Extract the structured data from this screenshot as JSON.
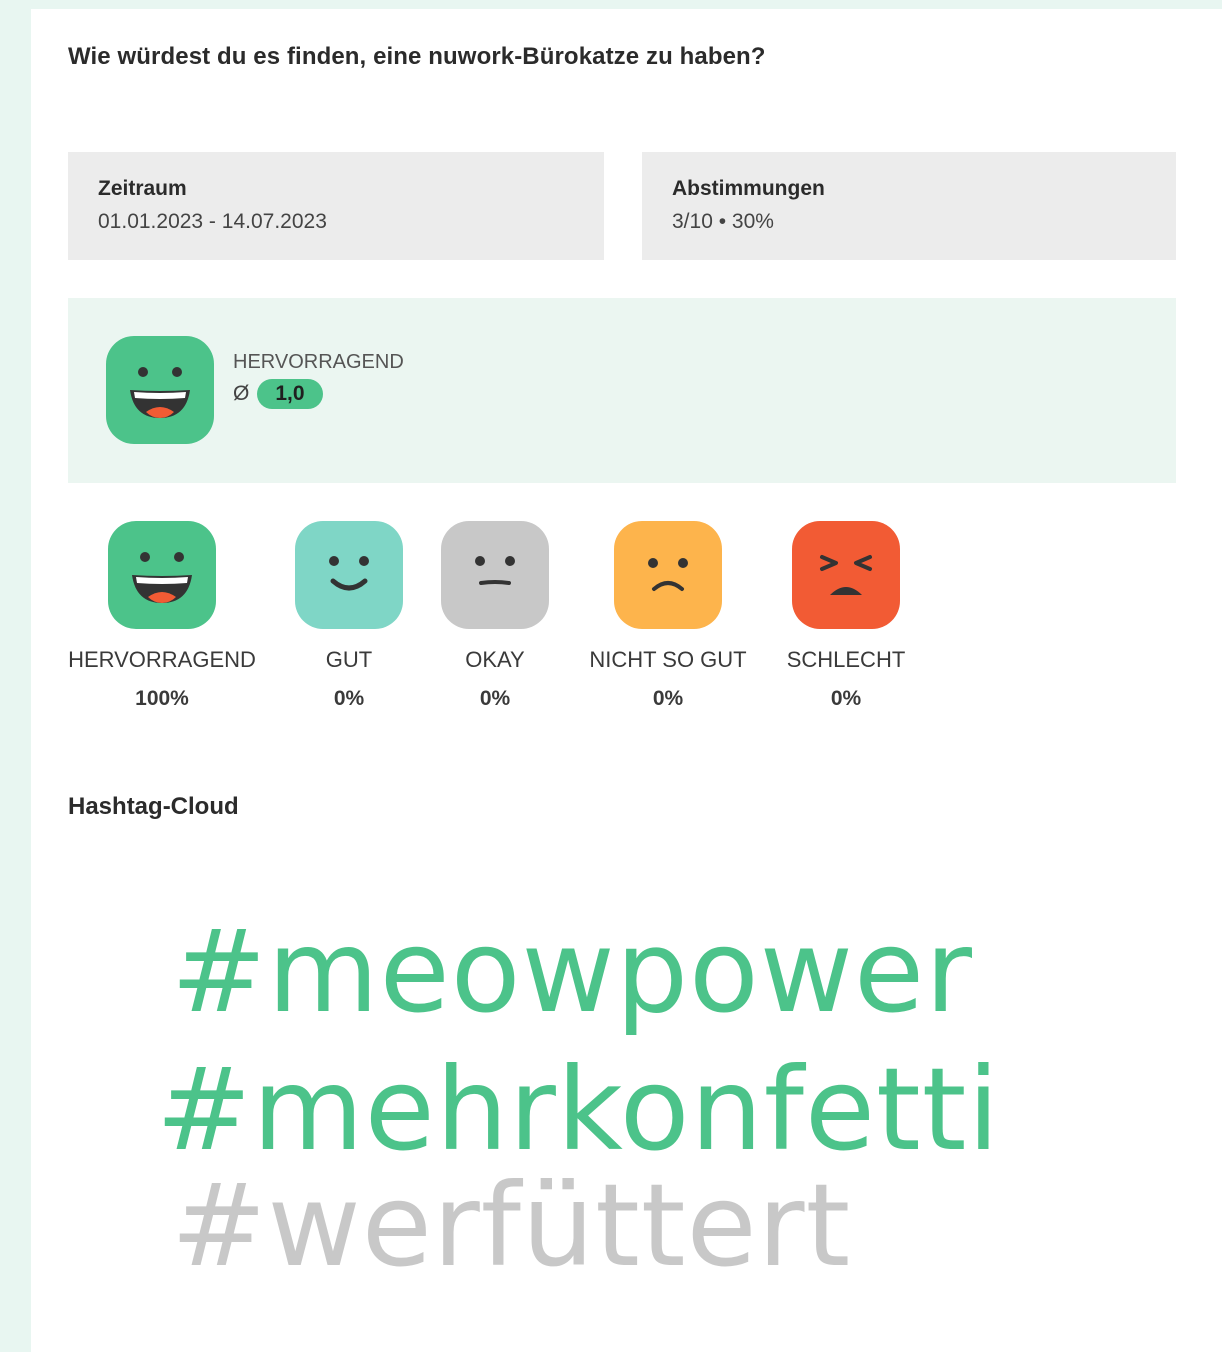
{
  "question": "Wie würdest du es finden, eine nuwork-Bürokatze zu haben?",
  "period": {
    "label": "Zeitraum",
    "value": "01.01.2023 - 14.07.2023"
  },
  "votes": {
    "label": "Abstimmungen",
    "value": "3/10 • 30%"
  },
  "summary": {
    "label": "HERVORRAGEND",
    "avg_symbol": "Ø",
    "avg_value": "1,0",
    "icon": "smiley-excellent-icon"
  },
  "ratings": [
    {
      "label": "HERVORRAGEND",
      "percent": "100%",
      "color": "#4cc38a",
      "icon": "smiley-excellent-icon"
    },
    {
      "label": "GUT",
      "percent": "0%",
      "color": "#7fd6c6",
      "icon": "smiley-good-icon"
    },
    {
      "label": "OKAY",
      "percent": "0%",
      "color": "#c8c8c8",
      "icon": "smiley-okay-icon"
    },
    {
      "label": "NICHT SO GUT",
      "percent": "0%",
      "color": "#fdb44c",
      "icon": "smiley-not-so-good-icon"
    },
    {
      "label": "SCHLECHT",
      "percent": "0%",
      "color": "#f25b34",
      "icon": "smiley-bad-icon"
    }
  ],
  "hashtag_cloud": {
    "title": "Hashtag-Cloud",
    "tags": [
      {
        "text": "#meowpower",
        "color": "#4cc38a"
      },
      {
        "text": "#mehrkonfetti",
        "color": "#4cc38a"
      },
      {
        "text": "#werfüttert",
        "color": "#c8c8c8"
      }
    ]
  }
}
